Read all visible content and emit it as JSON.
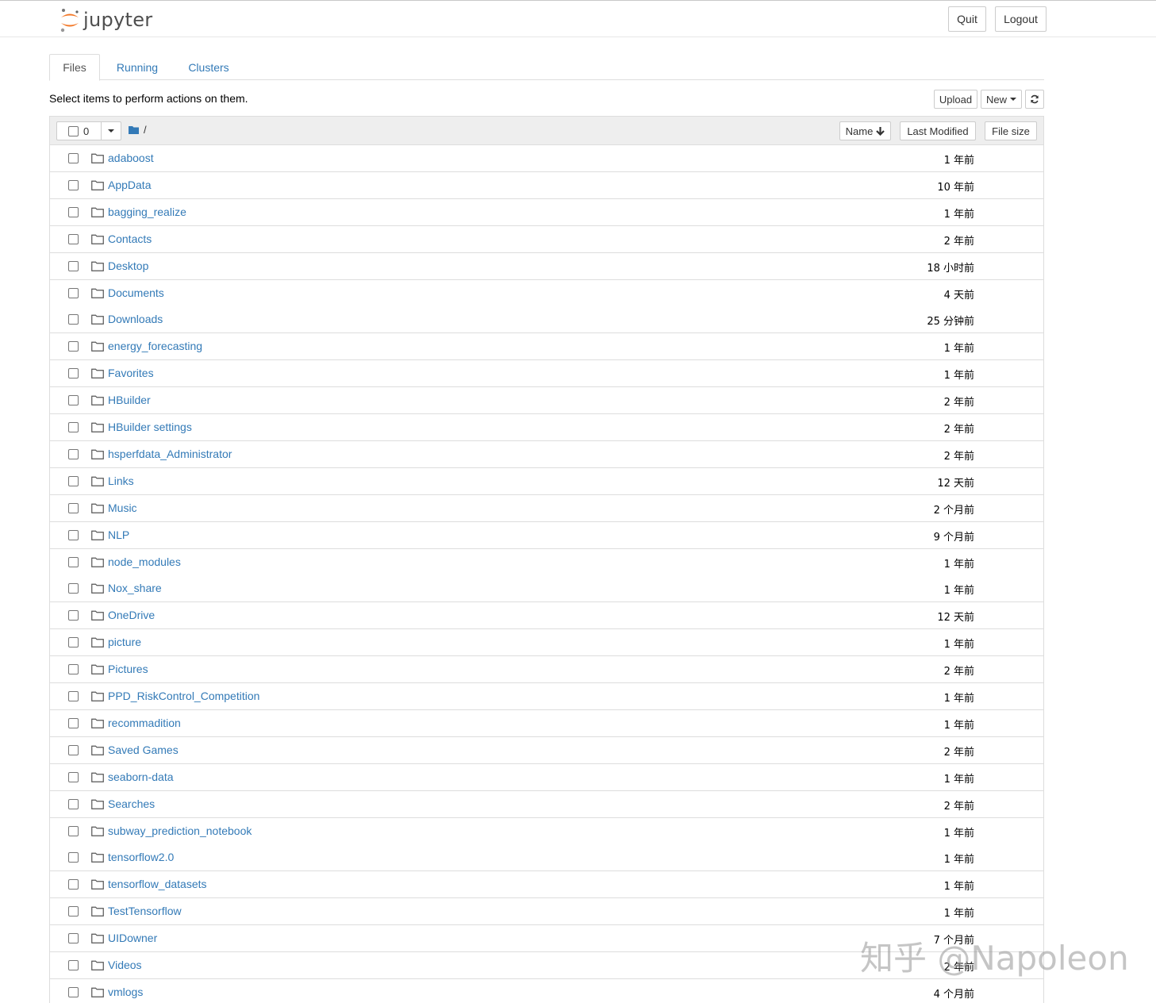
{
  "header": {
    "logo_text": "jupyter",
    "quit_label": "Quit",
    "logout_label": "Logout"
  },
  "tabs": [
    {
      "label": "Files",
      "active": true
    },
    {
      "label": "Running",
      "active": false
    },
    {
      "label": "Clusters",
      "active": false
    }
  ],
  "toolbar": {
    "hint": "Select items to perform actions on them.",
    "upload_label": "Upload",
    "new_label": "New",
    "refresh_icon": "refresh-icon"
  },
  "list_header": {
    "selected_count": "0",
    "breadcrumb": "/",
    "name_label": "Name",
    "last_modified_label": "Last Modified",
    "file_size_label": "File size"
  },
  "items": [
    {
      "name": "adaboost",
      "modified": "1 年前"
    },
    {
      "name": "AppData",
      "modified": "10 年前"
    },
    {
      "name": "bagging_realize",
      "modified": "1 年前"
    },
    {
      "name": "Contacts",
      "modified": "2 年前"
    },
    {
      "name": "Desktop",
      "modified": "18 小时前"
    },
    {
      "name": "Documents",
      "modified": "4 天前"
    },
    {
      "name": "Downloads",
      "modified": "25 分钟前"
    },
    {
      "name": "energy_forecasting",
      "modified": "1 年前"
    },
    {
      "name": "Favorites",
      "modified": "1 年前"
    },
    {
      "name": "HBuilder",
      "modified": "2 年前"
    },
    {
      "name": "HBuilder settings",
      "modified": "2 年前"
    },
    {
      "name": "hsperfdata_Administrator",
      "modified": "2 年前"
    },
    {
      "name": "Links",
      "modified": "12 天前"
    },
    {
      "name": "Music",
      "modified": "2 个月前"
    },
    {
      "name": "NLP",
      "modified": "9 个月前"
    },
    {
      "name": "node_modules",
      "modified": "1 年前"
    },
    {
      "name": "Nox_share",
      "modified": "1 年前"
    },
    {
      "name": "OneDrive",
      "modified": "12 天前"
    },
    {
      "name": "picture",
      "modified": "1 年前"
    },
    {
      "name": "Pictures",
      "modified": "2 年前"
    },
    {
      "name": "PPD_RiskControl_Competition",
      "modified": "1 年前"
    },
    {
      "name": "recommadition",
      "modified": "1 年前"
    },
    {
      "name": "Saved Games",
      "modified": "2 年前"
    },
    {
      "name": "seaborn-data",
      "modified": "1 年前"
    },
    {
      "name": "Searches",
      "modified": "2 年前"
    },
    {
      "name": "subway_prediction_notebook",
      "modified": "1 年前"
    },
    {
      "name": "tensorflow2.0",
      "modified": "1 年前"
    },
    {
      "name": "tensorflow_datasets",
      "modified": "1 年前"
    },
    {
      "name": "TestTensorflow",
      "modified": "1 年前"
    },
    {
      "name": "UIDowner",
      "modified": "7 个月前"
    },
    {
      "name": "Videos",
      "modified": "2 年前"
    },
    {
      "name": "vmlogs",
      "modified": "4 个月前"
    }
  ],
  "watermark": "知乎 @Napoleon",
  "colors": {
    "link": "#337ab7",
    "logo_orange": "#f37726",
    "folder_blue": "#337ab7"
  }
}
